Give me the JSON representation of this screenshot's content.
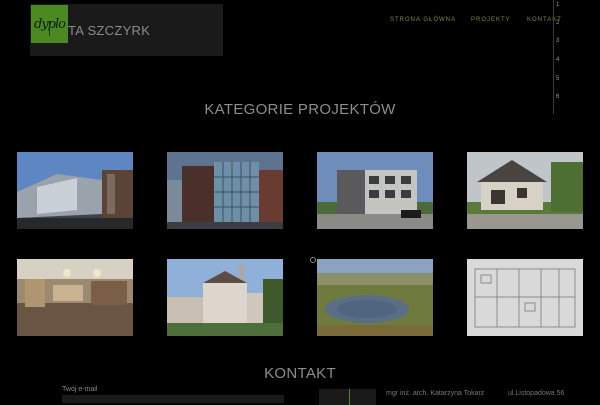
{
  "header": {
    "logo_text": "dyplo",
    "site_title": "TA SZCZYRK"
  },
  "nav": {
    "items": [
      {
        "label": "STRONA GŁÓWNA"
      },
      {
        "label": "PROJEKTY"
      },
      {
        "label": "KONTAKT"
      }
    ]
  },
  "side_rail": {
    "numbers": [
      "1",
      "2",
      "3",
      "4",
      "5",
      "6"
    ]
  },
  "categories": {
    "title": "KATEGORIE PROJEKTÓW",
    "thumbnails": [
      {
        "name": "thumb-cultural-building"
      },
      {
        "name": "thumb-glass-office"
      },
      {
        "name": "thumb-apartment-block"
      },
      {
        "name": "thumb-family-house"
      },
      {
        "name": "thumb-interior"
      },
      {
        "name": "thumb-historic-factory"
      },
      {
        "name": "thumb-landscape-lake"
      },
      {
        "name": "thumb-floor-plan"
      }
    ]
  },
  "contact": {
    "title": "KONTAKT",
    "email_label": "Twój e-mail",
    "name": "mgr inż. arch. Katarzyna  Tokarz",
    "address": "ul.Listopadowa 56"
  },
  "colors": {
    "accent": "#4b8a23",
    "background": "#000000"
  }
}
